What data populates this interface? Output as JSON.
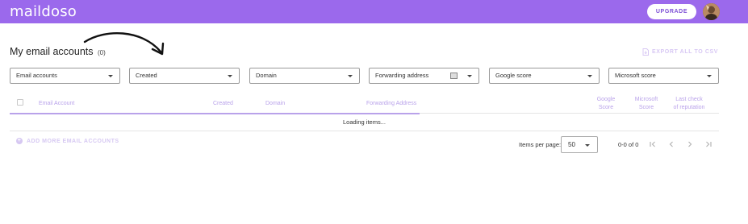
{
  "app": {
    "logo": "maildoso"
  },
  "header": {
    "upgrade_label": "UPGRADE",
    "avatar_icon": "user-avatar"
  },
  "page": {
    "title": "My email accounts",
    "count": "(0)",
    "export_label": "EXPORT ALL TO CSV",
    "export_icon": "file-download-icon"
  },
  "filters": [
    {
      "label": "Email accounts"
    },
    {
      "label": "Created"
    },
    {
      "label": "Domain"
    },
    {
      "label": "Forwarding address"
    },
    {
      "label": "Google score"
    },
    {
      "label": "Microsoft score"
    }
  ],
  "table": {
    "columns": [
      {
        "label": "Email Account"
      },
      {
        "label": "Created"
      },
      {
        "label": "Domain"
      },
      {
        "label": "Forwarding Address"
      },
      {
        "line1": "Google",
        "line2": "Score"
      },
      {
        "line1": "Microsoft",
        "line2": "Score"
      },
      {
        "line1": "Last check",
        "line2": "of reputation"
      }
    ],
    "loading_text": "Loading items..."
  },
  "footer": {
    "add_more_label": "ADD MORE EMAIL ACCOUNTS",
    "add_icon": "plus-circle-icon",
    "items_per_page_label": "Items per page:",
    "items_per_page_value": "50",
    "range_text": "0-0 of 0",
    "pager_icons": [
      "first-page-icon",
      "prev-page-icon",
      "next-page-icon",
      "last-page-icon"
    ]
  },
  "colors": {
    "brand": "#9b69ec",
    "accent_light": "#b9a2ea",
    "disabled": "#d6c8f2"
  }
}
